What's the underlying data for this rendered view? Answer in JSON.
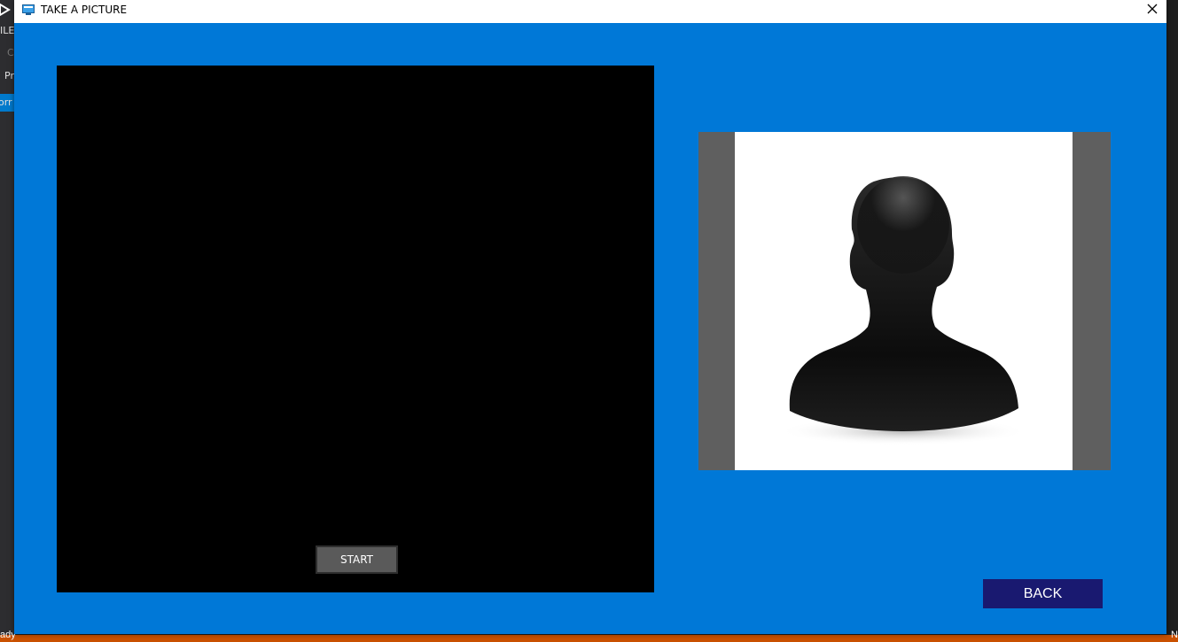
{
  "window": {
    "title": "TAKE A PICTURE",
    "close_icon": "close-icon",
    "background_color": "#0078d7"
  },
  "video": {
    "start_label": "START"
  },
  "picture": {
    "placeholder_icon": "person-silhouette-icon"
  },
  "actions": {
    "back_label": "BACK",
    "back_color": "#191970"
  },
  "background_ide": {
    "left_fragments": [
      "ILE",
      "C",
      "Pr",
      "orr"
    ],
    "bottom_left": "ady",
    "bottom_right": "N"
  }
}
